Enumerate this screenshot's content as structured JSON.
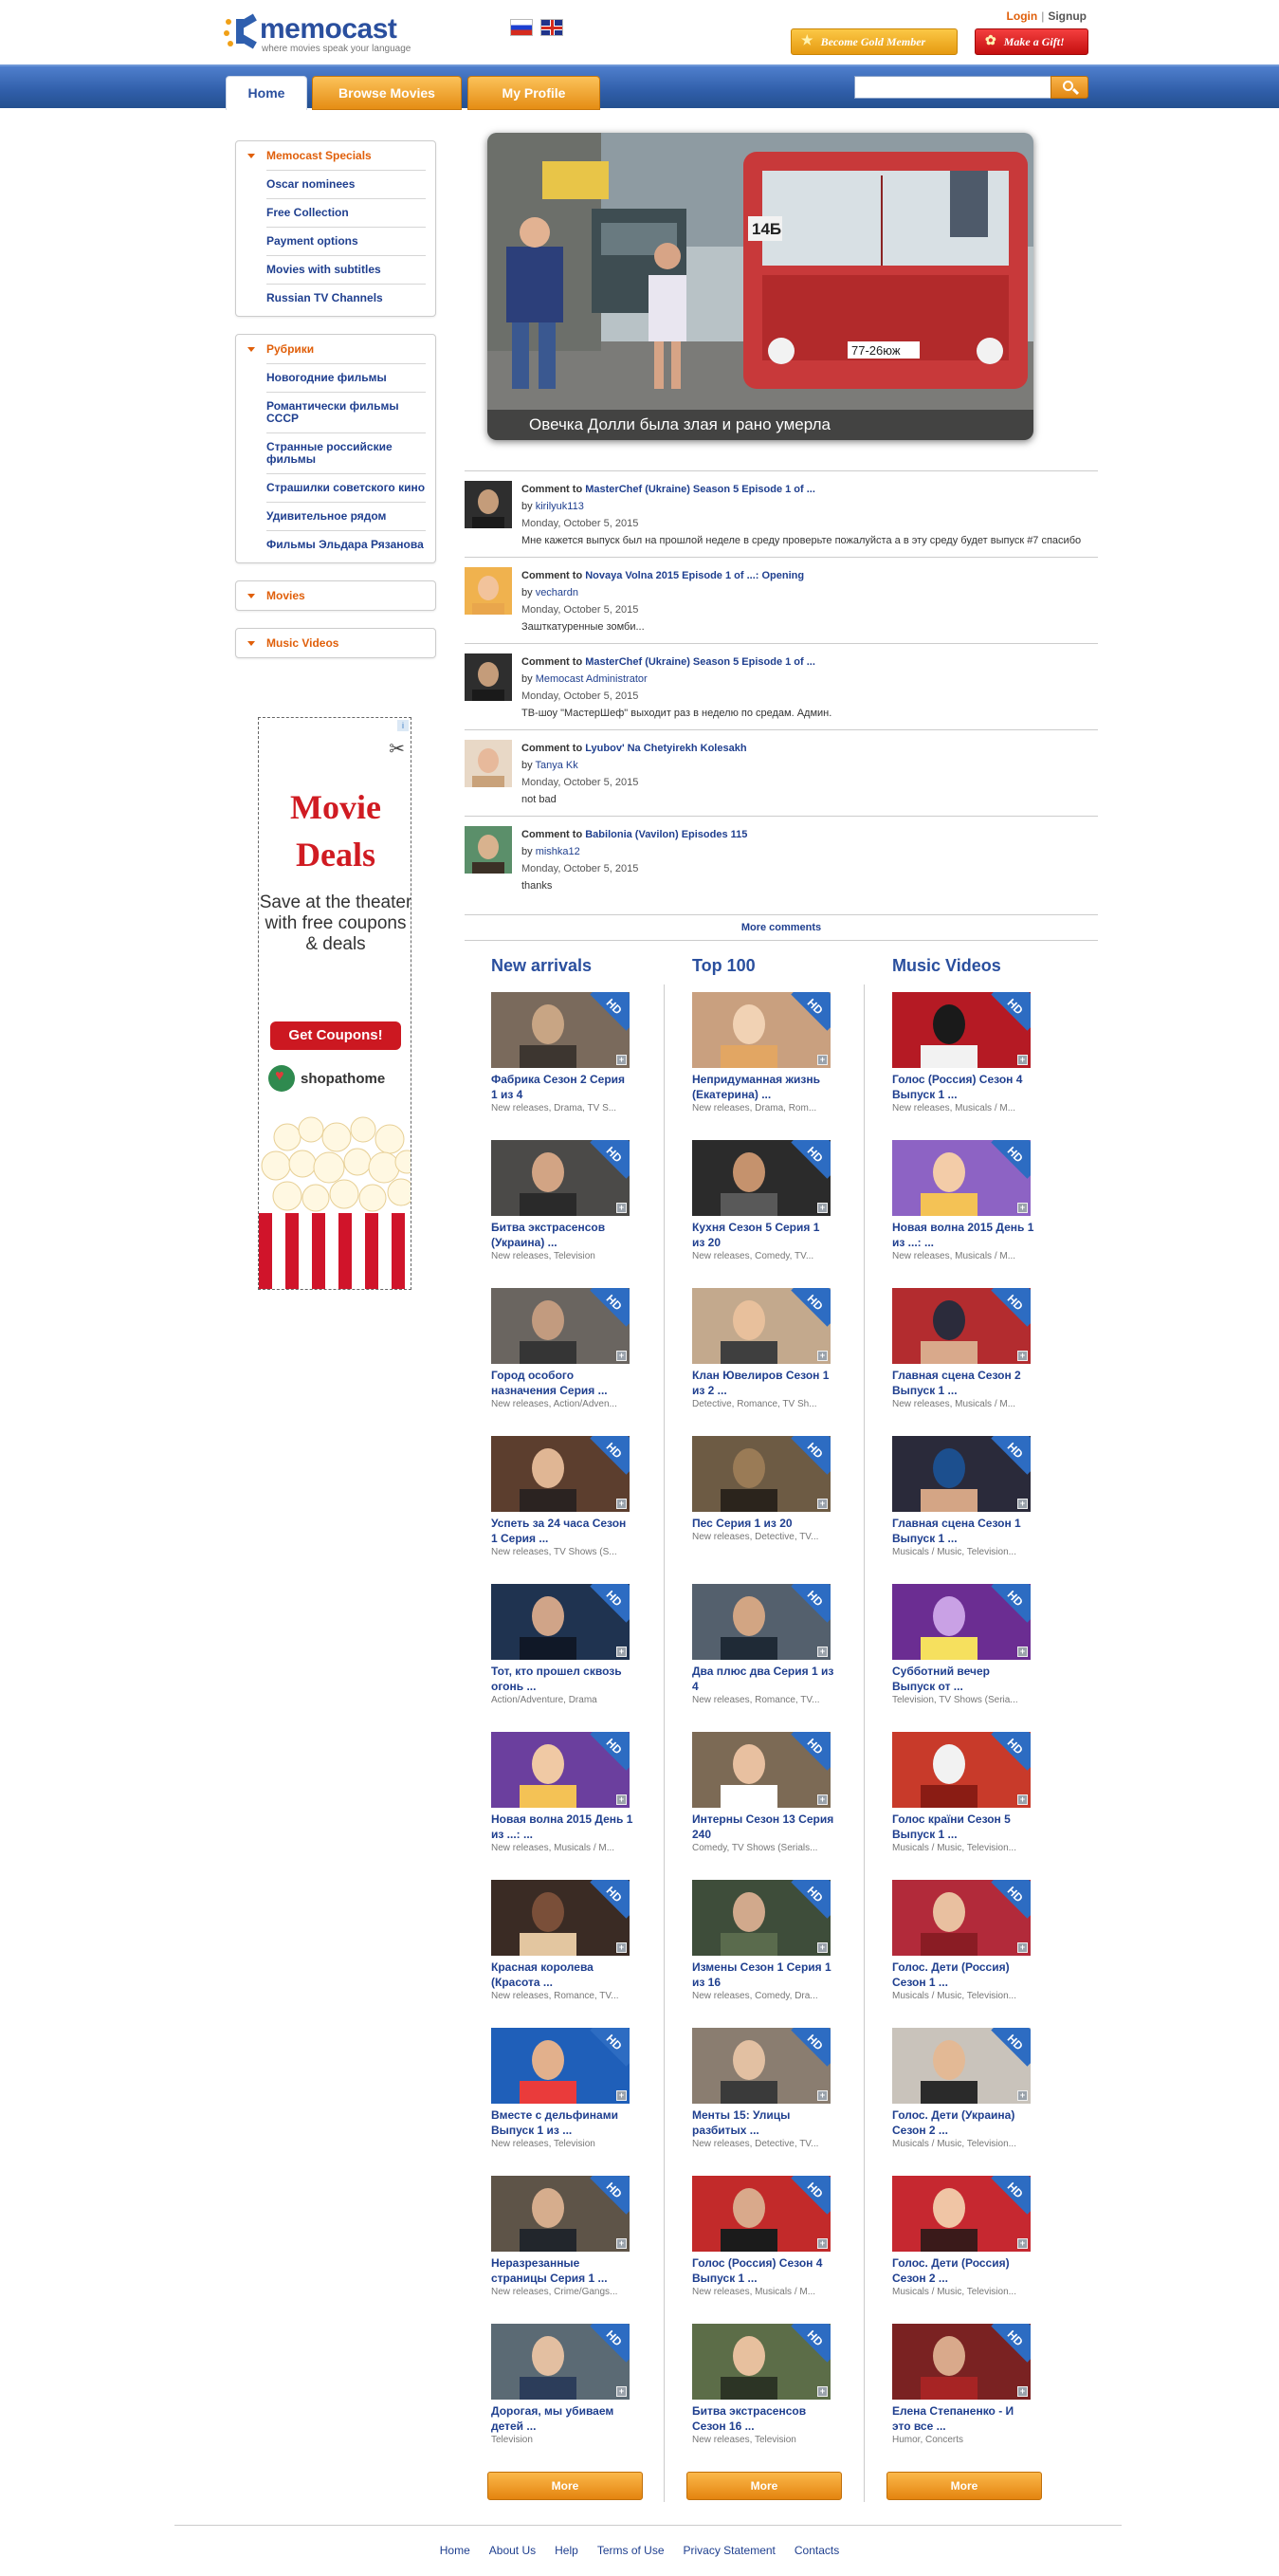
{
  "header": {
    "logo_name": "memocast",
    "logo_tagline": "where movies speak your language",
    "login": "Login",
    "separator": "|",
    "signup": "Signup",
    "gold_button": "Become Gold Member",
    "gift_button": "Make a Gift!"
  },
  "nav": {
    "tabs": [
      "Home",
      "Browse Movies",
      "My Profile"
    ],
    "search_placeholder": ""
  },
  "sidebar": {
    "sections": [
      {
        "title": "Memocast Specials",
        "items": [
          "Oscar nominees",
          "Free Collection",
          "Payment options",
          "Movies with subtitles",
          "Russian TV Channels"
        ]
      },
      {
        "title": "Рубрики",
        "items": [
          "Новогодние фильмы",
          "Романтически фильмы СССР",
          "Странные российские фильмы",
          "Страшилки советского кино",
          "Удивительное рядом",
          "Фильмы Эльдара Рязанова"
        ]
      },
      {
        "title": "Movies",
        "items": []
      },
      {
        "title": "Music Videos",
        "items": []
      }
    ]
  },
  "ad": {
    "title_line1": "Movie",
    "title_line2": "Deals",
    "body": "Save at the theater with free coupons & deals",
    "cta": "Get Coupons!",
    "brand": "shopathome"
  },
  "slider": {
    "caption": "Овечка Долли была злая и рано умерла",
    "plate": "77-26юж",
    "route": "14Б"
  },
  "comments": {
    "label": "Comment to",
    "by_label": "by",
    "items": [
      {
        "movie": "MasterChef (Ukraine) Season 5 Episode 1 of ...",
        "user": "kirilyuk113",
        "date": "Monday, October 5, 2015",
        "text": "Мне кажется выпуск был на прошлой неделе в среду проверьте пожалуйста а в эту среду будет выпуск #7 спасибо"
      },
      {
        "movie": "Novaya Volna 2015 Episode 1 of ...: Opening",
        "user": "vechardn",
        "date": "Monday, October 5, 2015",
        "text": "Зашткатуренные зомби..."
      },
      {
        "movie": "MasterChef (Ukraine) Season 5 Episode 1 of ...",
        "user": "Memocast Administrator",
        "date": "Monday, October 5, 2015",
        "text": "ТВ-шоу \"МастерШеф\" выходит раз в неделю по средам. Админ."
      },
      {
        "movie": "Lyubov' Na Chetyirekh Kolesakh",
        "user": "Tanya Kk",
        "date": "Monday, October 5, 2015",
        "text": "not bad"
      },
      {
        "movie": "Babilonia (Vavilon) Episodes 115",
        "user": "mishka12",
        "date": "Monday, October 5, 2015",
        "text": "thanks"
      }
    ],
    "more": "More comments"
  },
  "columns": [
    {
      "title": "New arrivals",
      "more": "More",
      "items": [
        {
          "title": "Фабрика Сезон 2 Серия 1 из 4",
          "genre": "New releases, Drama, TV S..."
        },
        {
          "title": "Битва экстрасенсов (Украина) ...",
          "genre": "New releases, Television"
        },
        {
          "title": "Город особого назначения Серия ...",
          "genre": "New releases, Action/Adven..."
        },
        {
          "title": "Успеть за 24 часа Сезон 1 Серия ...",
          "genre": "New releases, TV Shows (S..."
        },
        {
          "title": "Тот, кто прошел сквозь огонь ...",
          "genre": "Action/Adventure, Drama"
        },
        {
          "title": "Новая волна 2015 День 1 из ...: ...",
          "genre": "New releases, Musicals / M..."
        },
        {
          "title": "Красная королева (Красота ...",
          "genre": "New releases, Romance, TV..."
        },
        {
          "title": "Вместе с дельфинами Выпуск 1 из ...",
          "genre": "New releases, Television"
        },
        {
          "title": "Неразрезанные страницы Серия 1 ...",
          "genre": "New releases, Crime/Gangs..."
        },
        {
          "title": "Дорогая, мы убиваем детей ...",
          "genre": "Television"
        }
      ]
    },
    {
      "title": "Top 100",
      "more": "More",
      "items": [
        {
          "title": "Непридуманная жизнь (Екатерина) ...",
          "genre": "New releases, Drama, Rom..."
        },
        {
          "title": "Кухня Сезон 5 Серия 1 из 20",
          "genre": "New releases, Comedy, TV..."
        },
        {
          "title": "Клан Ювелиров Сезон 1 из 2 ...",
          "genre": "Detective, Romance, TV Sh..."
        },
        {
          "title": "Пес Серия 1 из 20",
          "genre": "New releases, Detective, TV..."
        },
        {
          "title": "Два плюс два Серия 1 из 4",
          "genre": "New releases, Romance, TV..."
        },
        {
          "title": "Интерны Сезон 13 Серия 240",
          "genre": "Comedy, TV Shows (Serials..."
        },
        {
          "title": "Измены Сезон 1 Серия 1 из 16",
          "genre": "New releases, Comedy, Dra..."
        },
        {
          "title": "Менты 15: Улицы разбитых ...",
          "genre": "New releases, Detective, TV..."
        },
        {
          "title": "Голос (Россия) Сезон 4 Выпуск 1 ...",
          "genre": "New releases, Musicals / M..."
        },
        {
          "title": "Битва экстрасенсов Сезон 16 ...",
          "genre": "New releases, Television"
        }
      ]
    },
    {
      "title": "Music Videos",
      "more": "More",
      "items": [
        {
          "title": "Голос (Россия) Сезон 4 Выпуск 1 ...",
          "genre": "New releases, Musicals / M..."
        },
        {
          "title": "Новая волна 2015 День 1 из ...: ...",
          "genre": "New releases, Musicals / M..."
        },
        {
          "title": "Главная сцена Сезон 2 Выпуск 1 ...",
          "genre": "New releases, Musicals / M..."
        },
        {
          "title": "Главная сцена Сезон 1 Выпуск 1 ...",
          "genre": "Musicals / Music, Television..."
        },
        {
          "title": "Субботний вечер Выпуск от ...",
          "genre": "Television, TV Shows (Seria..."
        },
        {
          "title": "Голос країни Сезон 5 Выпуск 1 ...",
          "genre": "Musicals / Music, Television..."
        },
        {
          "title": "Голос. Дети (Россия) Сезон 1 ...",
          "genre": "Musicals / Music, Television..."
        },
        {
          "title": "Голос. Дети (Украина) Сезон 2 ...",
          "genre": "Musicals / Music, Television..."
        },
        {
          "title": "Голос. Дети (Россия) Сезон 2 ...",
          "genre": "Musicals / Music, Television..."
        },
        {
          "title": "Елена Степаненко - И это все ...",
          "genre": "Humor, Concerts"
        }
      ]
    }
  ],
  "thumb_badge": "HD",
  "footer": {
    "links": [
      "Home",
      "About Us",
      "Help",
      "Terms of Use",
      "Privacy Statement",
      "Contacts"
    ]
  }
}
